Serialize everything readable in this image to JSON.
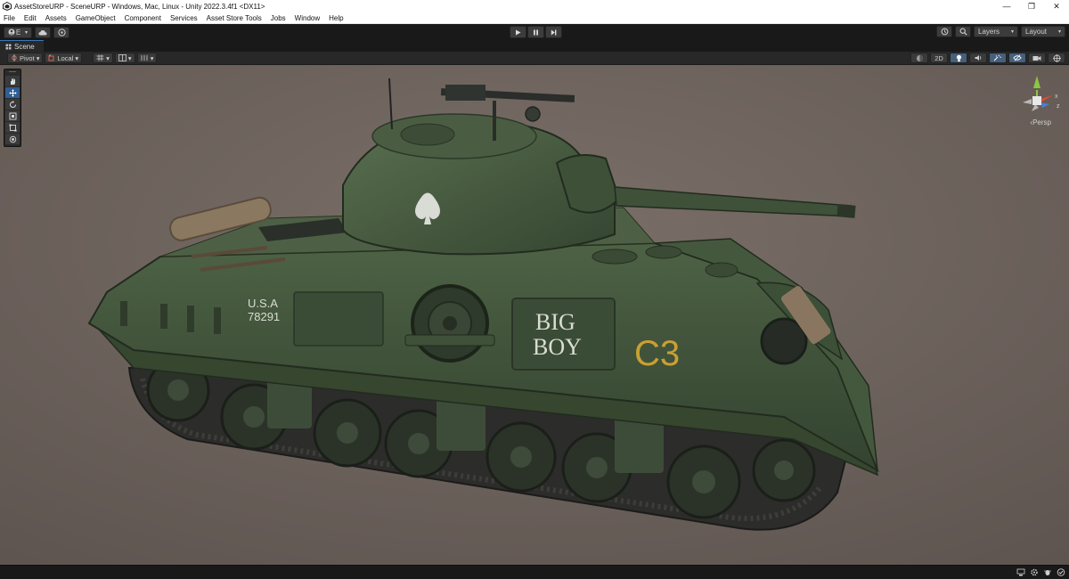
{
  "window": {
    "title": "AssetStoreURP - SceneURP - Windows, Mac, Linux - Unity 2022.3.4f1 <DX11>",
    "controls": {
      "minimize": "—",
      "restore": "❐",
      "close": "✕"
    }
  },
  "menu": {
    "items": [
      "File",
      "Edit",
      "Assets",
      "GameObject",
      "Component",
      "Services",
      "Asset Store Tools",
      "Jobs",
      "Window",
      "Help"
    ]
  },
  "toolbar": {
    "account_label": "E",
    "layers_label": "Layers",
    "layout_label": "Layout",
    "icons": {
      "account": "account-icon",
      "cloud": "cloud-icon",
      "collab": "collab-icon",
      "play": "play-icon",
      "pause": "pause-icon",
      "step": "step-icon",
      "history": "history-icon",
      "search": "search-icon"
    }
  },
  "scene_tab": {
    "label": "Scene"
  },
  "scene_toolbar": {
    "pivot_label": "Pivot",
    "local_label": "Local",
    "mode_2d_label": "2D"
  },
  "viewport": {
    "camera_label": "Persp",
    "tank": {
      "hull_text_line1": "U.S.A",
      "hull_text_line2": "78291",
      "nickname_line1": "BIG",
      "nickname_line2": "BOY",
      "callsign": "C3"
    },
    "gizmo_axes": {
      "x": "x",
      "z": "z"
    }
  },
  "colors": {
    "background": "#6b605a",
    "tank_green": "#3f5138",
    "accent_blue": "#2f5e92",
    "callsign_yellow": "#c9a032"
  }
}
